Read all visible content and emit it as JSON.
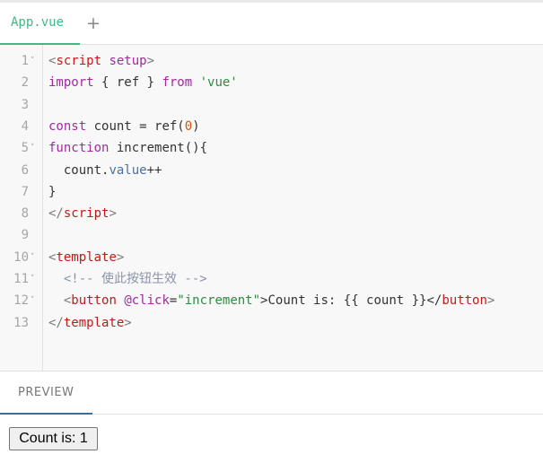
{
  "tabs": [
    {
      "label": "App.vue",
      "active": true
    }
  ],
  "add_tab_label": "+",
  "editor": {
    "line_numbers": [
      "1",
      "2",
      "3",
      "4",
      "5",
      "6",
      "7",
      "8",
      "9",
      "10",
      "11",
      "12",
      "13"
    ],
    "fold_markers": {
      "1": "˅",
      "5": "˅",
      "10": "˅",
      "11": "˅",
      "12": "˅"
    },
    "lines": [
      [
        {
          "t": "<",
          "c": "punc"
        },
        {
          "t": "script",
          "c": "tag"
        },
        {
          "t": " ",
          "c": "plain"
        },
        {
          "t": "setup",
          "c": "attr"
        },
        {
          "t": ">",
          "c": "punc"
        }
      ],
      [
        {
          "t": "import",
          "c": "kw"
        },
        {
          "t": " { ref } ",
          "c": "plain"
        },
        {
          "t": "from",
          "c": "kw"
        },
        {
          "t": " ",
          "c": "plain"
        },
        {
          "t": "'vue'",
          "c": "str"
        }
      ],
      [],
      [
        {
          "t": "const",
          "c": "kw"
        },
        {
          "t": " count = ref(",
          "c": "plain"
        },
        {
          "t": "0",
          "c": "num"
        },
        {
          "t": ")",
          "c": "plain"
        }
      ],
      [
        {
          "t": "function",
          "c": "kw"
        },
        {
          "t": " increment(){",
          "c": "plain"
        }
      ],
      [
        {
          "t": "  count.",
          "c": "plain"
        },
        {
          "t": "value",
          "c": "prop"
        },
        {
          "t": "++",
          "c": "plain"
        }
      ],
      [
        {
          "t": "}",
          "c": "plain"
        }
      ],
      [
        {
          "t": "</",
          "c": "punc"
        },
        {
          "t": "script",
          "c": "tag"
        },
        {
          "t": ">",
          "c": "punc"
        }
      ],
      [],
      [
        {
          "t": "<",
          "c": "punc"
        },
        {
          "t": "template",
          "c": "tag"
        },
        {
          "t": ">",
          "c": "punc"
        }
      ],
      [
        {
          "t": "  <!-- 使此按钮生效 -->",
          "c": "cmt"
        }
      ],
      [
        {
          "t": "  <",
          "c": "punc"
        },
        {
          "t": "button",
          "c": "tag"
        },
        {
          "t": " ",
          "c": "plain"
        },
        {
          "t": "@click",
          "c": "attr"
        },
        {
          "t": "=",
          "c": "plain"
        },
        {
          "t": "\"increment\"",
          "c": "str"
        },
        {
          "t": ">Count is: {{ count }}</",
          "c": "plain"
        },
        {
          "t": "button",
          "c": "tag"
        },
        {
          "t": ">",
          "c": "punc"
        }
      ],
      [
        {
          "t": "</",
          "c": "punc"
        },
        {
          "t": "template",
          "c": "tag"
        },
        {
          "t": ">",
          "c": "punc"
        }
      ]
    ]
  },
  "preview": {
    "tab_label": "PREVIEW",
    "button_label": "Count is: 1"
  },
  "colors": {
    "accent": "#42b883",
    "preview_underline": "#3e6e94"
  }
}
